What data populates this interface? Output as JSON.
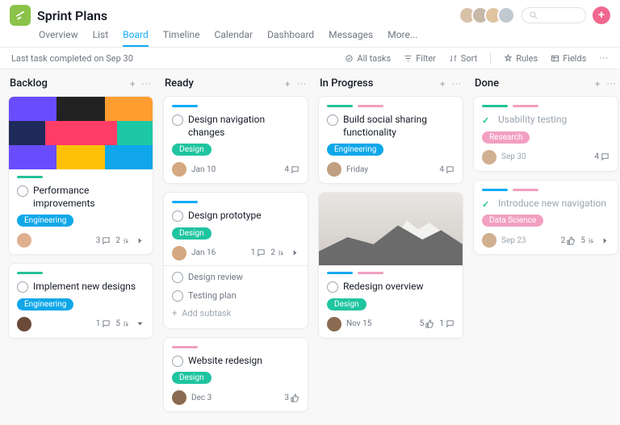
{
  "header": {
    "title": "Sprint Plans"
  },
  "tabs": {
    "items": [
      "Overview",
      "List",
      "Board",
      "Timeline",
      "Calendar",
      "Dashboard",
      "Messages",
      "More..."
    ],
    "active": "Board"
  },
  "toolbar": {
    "status": "Last task completed on Sep 30",
    "alltasks": "All tasks",
    "filter": "Filter",
    "sort": "Sort",
    "rules": "Rules",
    "fields": "Fields"
  },
  "colors": {
    "teal": "#25c198",
    "blue": "#14aaf5",
    "pink": "#f0a0c0",
    "pill_engineering": "#0fa7e9",
    "pill_design": "#1fc4a0",
    "pill_research": "#f2a0c2",
    "pill_data": "#f2a0c2"
  },
  "pills": {
    "engineering": "Engineering",
    "design": "Design",
    "research": "Research",
    "data": "Data Science"
  },
  "columns": [
    {
      "title": "Backlog"
    },
    {
      "title": "Ready"
    },
    {
      "title": "In Progress"
    },
    {
      "title": "Done"
    }
  ],
  "cards": {
    "backlog1": {
      "title": "Performance improvements",
      "stats_comments": "3",
      "stats_subs": "2"
    },
    "backlog2": {
      "title": "Implement new designs",
      "stats_comments": "1",
      "stats_subs": "5"
    },
    "ready1": {
      "title": "Design navigation changes",
      "date": "Jan 10",
      "comments": "4"
    },
    "ready2": {
      "title": "Design prototype",
      "date": "Jan 16",
      "comments": "1",
      "subs": "2",
      "subtasks": {
        "a": "Design review",
        "b": "Testing plan",
        "add": "Add subtask"
      }
    },
    "ready3": {
      "title": "Website redesign",
      "date": "Dec 3",
      "likes": "3"
    },
    "prog1": {
      "title": "Build social sharing functionality",
      "date": "Friday",
      "comments": "4"
    },
    "prog2": {
      "title": "Redesign overview",
      "date": "Nov 15",
      "likes": "5",
      "comments": "1"
    },
    "done1": {
      "title": "Usability testing",
      "date": "Sep 30",
      "comments": "4"
    },
    "done2": {
      "title": "Introduce new navigation",
      "date": "Sep 23",
      "likes": "2",
      "subs": "5"
    }
  }
}
